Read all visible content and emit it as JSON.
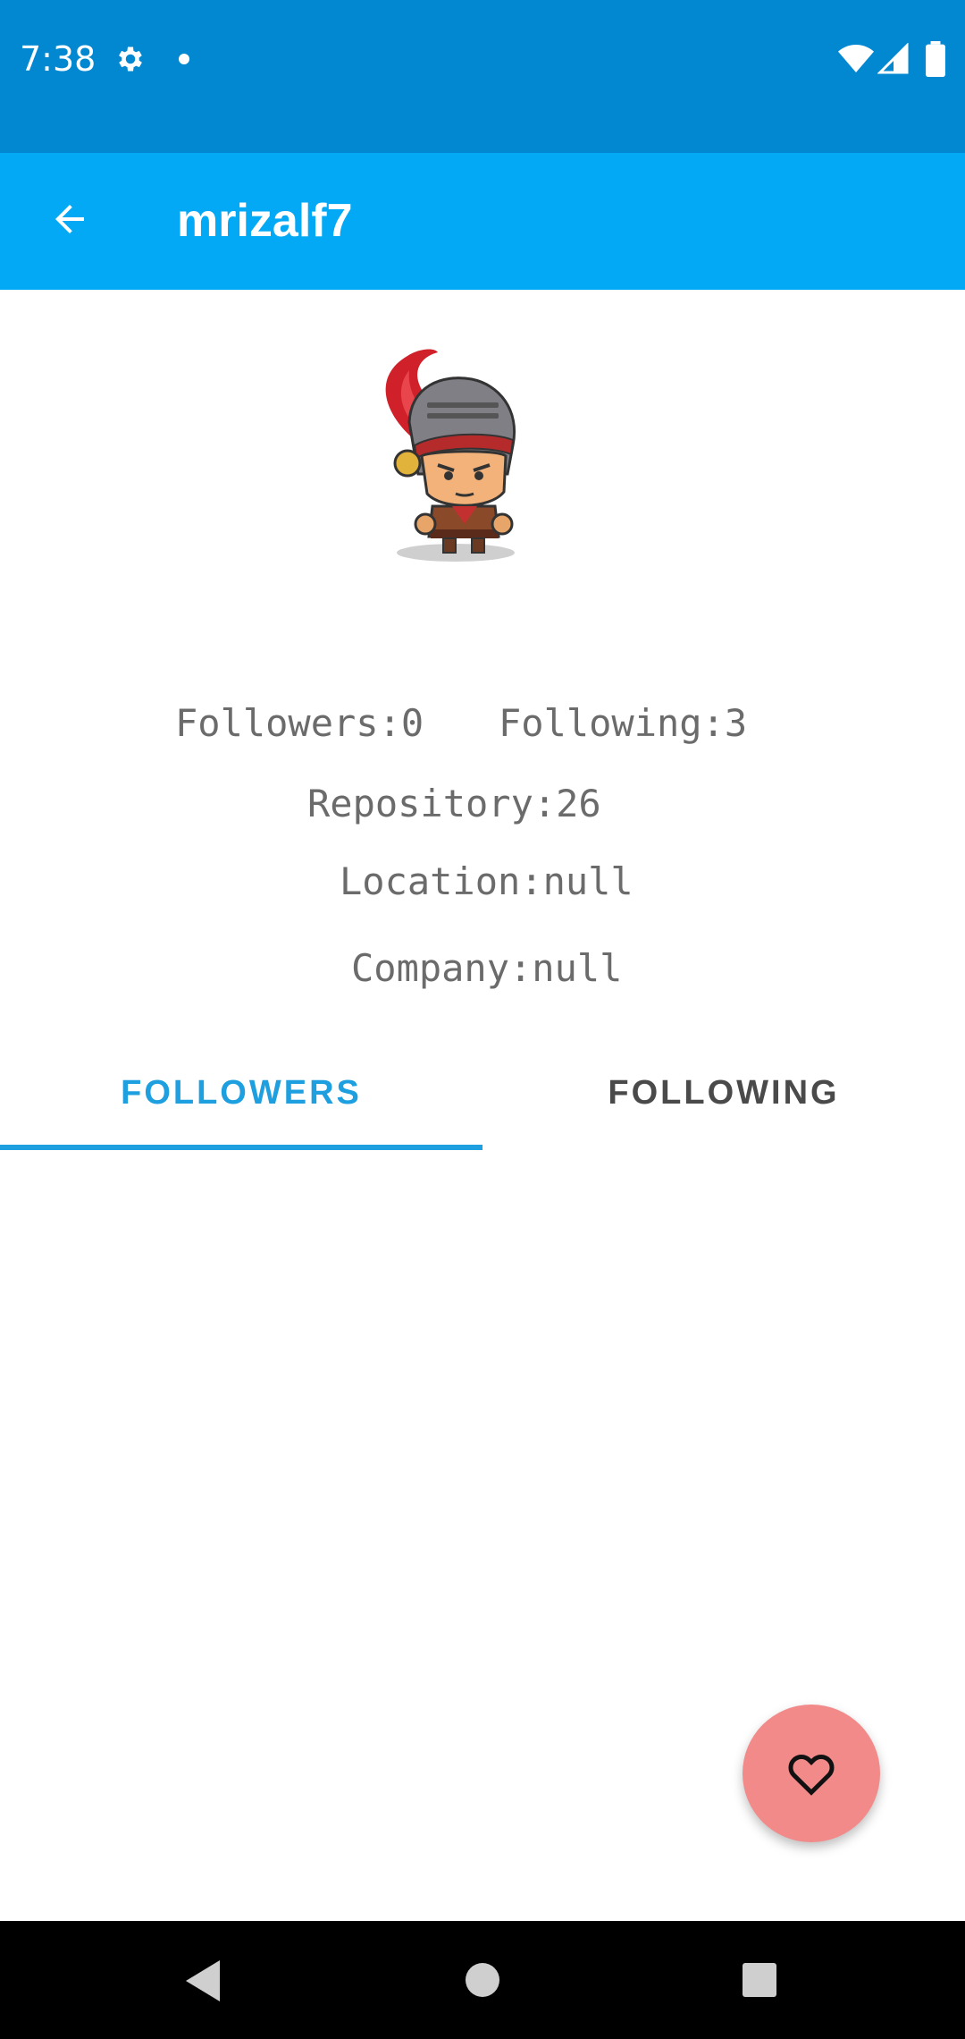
{
  "status_bar": {
    "time": "7:38",
    "icons": [
      "gear-icon",
      "dot-icon",
      "wifi-icon",
      "signal-icon",
      "battery-icon"
    ],
    "background": "#0288d1"
  },
  "app_bar": {
    "title": "mrizalf7",
    "back_icon": "arrow-back-icon",
    "background": "#03a9f4"
  },
  "profile": {
    "avatar": "knight-character-avatar",
    "followers": "Followers:0",
    "following": "Following:3",
    "repository": "Repository:26",
    "location": "Location:null",
    "company": "Company:null"
  },
  "tabs": {
    "items": [
      {
        "label": "FOLLOWERS",
        "selected": true
      },
      {
        "label": "FOLLOWING",
        "selected": false
      }
    ],
    "accent": "#1e9fe0"
  },
  "fab": {
    "icon": "heart-outline-icon",
    "color": "#f28a8a"
  },
  "nav_bar": {
    "icons": [
      "nav-back-icon",
      "nav-home-icon",
      "nav-recents-icon"
    ]
  }
}
